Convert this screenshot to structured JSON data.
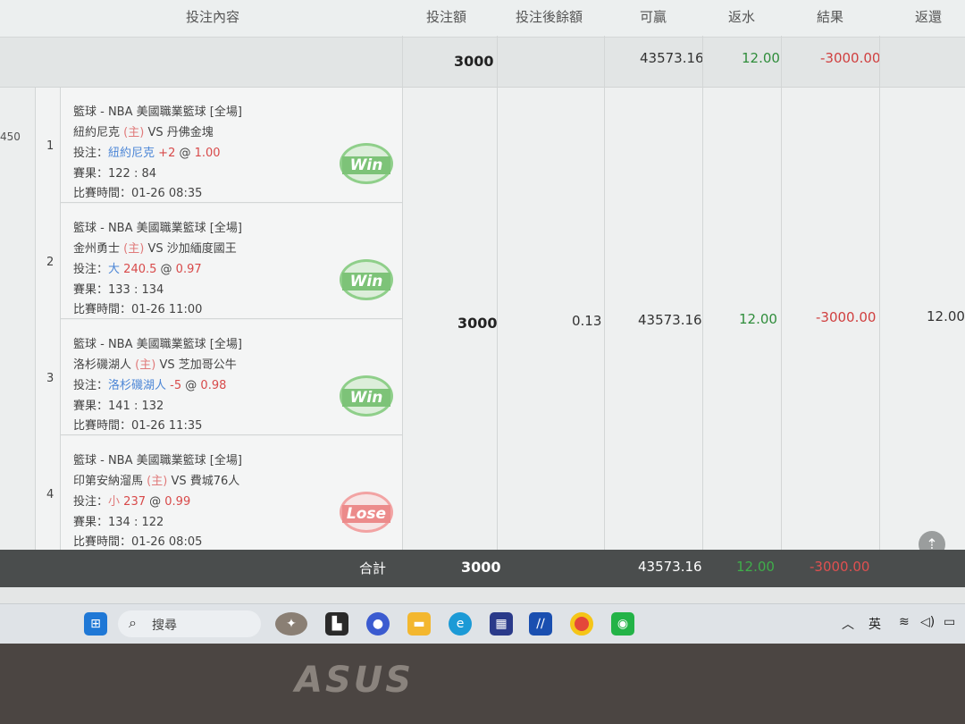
{
  "header": {
    "content": "投注內容",
    "amount": "投注額",
    "balance_after": "投注後餘額",
    "winnable": "可贏",
    "rebate": "返水",
    "result": "結果",
    "return": "返還"
  },
  "summary": {
    "amount": "3000",
    "winnable": "43573.16",
    "rebate": "12.00",
    "result": "-3000.00"
  },
  "row": {
    "id_fragment": "450",
    "amount": "3000",
    "balance_after": "0.13",
    "winnable": "43573.16",
    "rebate": "12.00",
    "result": "-3000.00",
    "return": "12.00"
  },
  "bets": [
    {
      "index": "1",
      "league": "籃球 - NBA 美國職業籃球 [全場]",
      "home": "紐約尼克",
      "home_tag": "(主)",
      "vs": "VS",
      "away": "丹佛金塊",
      "pick_label": "投注：",
      "pick_team": "紐約尼克",
      "pick_line": "+2",
      "at": "@",
      "odds": "1.00",
      "score": "賽果：122 : 84",
      "time": "比賽時間：01-26 08:35",
      "outcome": "Win"
    },
    {
      "index": "2",
      "league": "籃球 - NBA 美國職業籃球 [全場]",
      "home": "金州勇士",
      "home_tag": "(主)",
      "vs": "VS",
      "away": "沙加緬度國王",
      "pick_label": "投注：",
      "pick_team": "大",
      "pick_line": "240.5",
      "at": "@",
      "odds": "0.97",
      "score": "賽果：133 : 134",
      "time": "比賽時間：01-26 11:00",
      "outcome": "Win"
    },
    {
      "index": "3",
      "league": "籃球 - NBA 美國職業籃球 [全場]",
      "home": "洛杉磯湖人",
      "home_tag": "(主)",
      "vs": "VS",
      "away": "芝加哥公牛",
      "pick_label": "投注：",
      "pick_team": "洛杉磯湖人",
      "pick_line": "-5",
      "at": "@",
      "odds": "0.98",
      "score": "賽果：141 : 132",
      "time": "比賽時間：01-26 11:35",
      "outcome": "Win"
    },
    {
      "index": "4",
      "league": "籃球 - NBA 美國職業籃球 [全場]",
      "home": "印第安納溜馬",
      "home_tag": "(主)",
      "vs": "VS",
      "away": "費城76人",
      "pick_label": "投注：",
      "pick_team": "小",
      "pick_line": "237",
      "at": "@",
      "odds": "0.99",
      "score": "賽果：134 : 122",
      "time": "比賽時間：01-26 08:05",
      "outcome": "Lose"
    }
  ],
  "total": {
    "label": "合計",
    "amount": "3000",
    "winnable": "43573.16",
    "rebate": "12.00",
    "result": "-3000.00"
  },
  "taskbar": {
    "search_placeholder": "搜尋",
    "ime": "英",
    "apps": [
      "windows-start",
      "eagle-app",
      "file-black",
      "meet-app",
      "file-explorer",
      "edge",
      "store",
      "pen-app",
      "chrome",
      "line"
    ]
  },
  "bezel": {
    "brand": "ASUS"
  }
}
